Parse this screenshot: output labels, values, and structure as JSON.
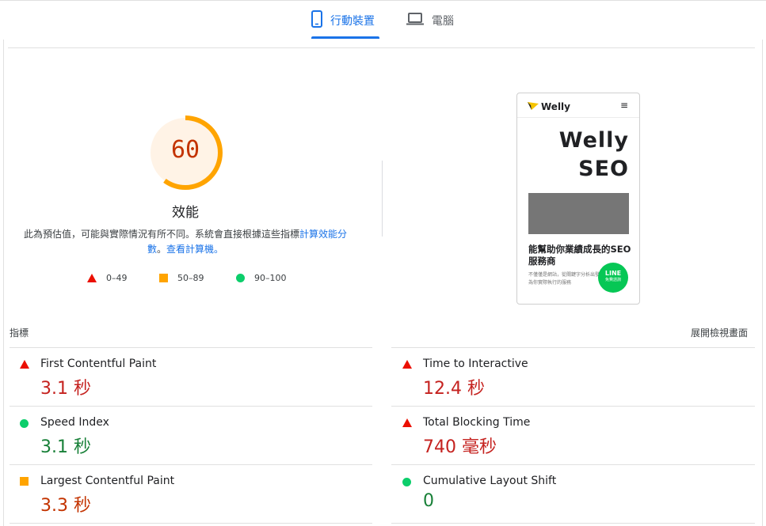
{
  "tabs": [
    {
      "label": "行動裝置",
      "icon": "mobile-phone-icon",
      "active": true
    },
    {
      "label": "電腦",
      "icon": "laptop-icon",
      "active": false
    }
  ],
  "score": {
    "value": "60",
    "fraction": 0.6,
    "label": "效能",
    "description_text": "此為預估值，可能與實際情況有所不同。系統會直接根據這些指標",
    "description_link1": "計算效能分數",
    "description_sep": "。",
    "description_link2": "查看計算機。"
  },
  "legend": [
    {
      "shape": "triangle",
      "range": "0–49",
      "color": "#eb0f00"
    },
    {
      "shape": "square",
      "range": "50–89",
      "color": "#ffa400"
    },
    {
      "shape": "circle",
      "range": "90–100",
      "color": "#0cce6b"
    }
  ],
  "preview": {
    "logo_text": "Welly",
    "menu_icon": "≡",
    "headline1": "Welly",
    "headline2": "SEO",
    "subhead": "能幫助你業績成長的SEO服務商",
    "small_text": "不僅僅是網站，從關鍵字分析出發能為你實際執行的服務",
    "line_label": "LINE",
    "line_sub": "免費諮詢"
  },
  "metrics_header": "指標",
  "expand_label": "展開檢視畫面",
  "metrics": [
    {
      "name": "First Contentful Paint",
      "value": "3.1 秒",
      "status": "fail"
    },
    {
      "name": "Time to Interactive",
      "value": "12.4 秒",
      "status": "fail"
    },
    {
      "name": "Speed Index",
      "value": "3.1 秒",
      "status": "pass"
    },
    {
      "name": "Total Blocking Time",
      "value": "740 毫秒",
      "status": "fail"
    },
    {
      "name": "Largest Contentful Paint",
      "value": "3.3 秒",
      "status": "average"
    },
    {
      "name": "Cumulative Layout Shift",
      "value": "0",
      "status": "pass"
    }
  ],
  "colors": {
    "accent": "#1a73e8",
    "fail": "#eb0f00",
    "average": "#ffa400",
    "pass": "#0cce6b",
    "gauge_bg": "#fff3e6",
    "gauge_score": "#c33300"
  }
}
